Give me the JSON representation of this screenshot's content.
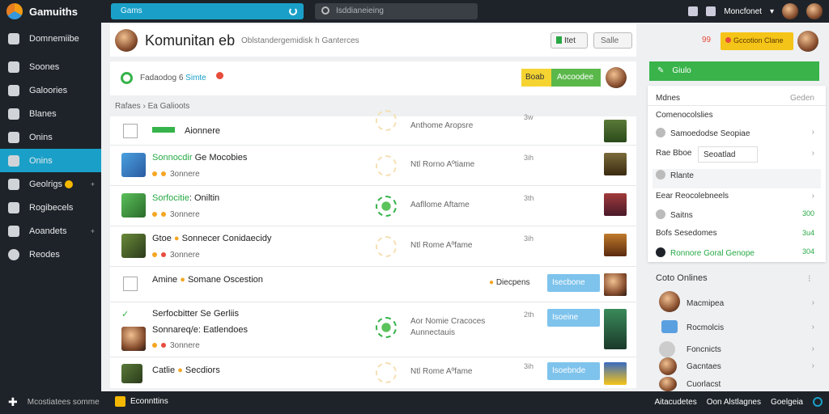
{
  "topbar": {
    "app_name": "Gamuiths",
    "tab_label": "Gams",
    "search_placeholder": "Isddianeieing",
    "user_name": "Moncfonet",
    "chevron": "▾"
  },
  "sidebar": {
    "items": [
      {
        "label": "Domnemiibe",
        "icon": "search-icon"
      },
      {
        "label": "Soones",
        "icon": "user-icon"
      },
      {
        "label": "Galoories",
        "icon": "people-icon"
      },
      {
        "label": "Blanes",
        "icon": "puzzle-icon"
      },
      {
        "label": "Onins",
        "icon": "monitor-icon"
      },
      {
        "label": "Onins",
        "icon": "list-icon",
        "active": true
      },
      {
        "label": "Geolrigs",
        "icon": "game-icon",
        "badge": true
      },
      {
        "label": "Rogibecels",
        "icon": "run-icon"
      },
      {
        "label": "Aoandets",
        "icon": "box-icon"
      },
      {
        "label": "Reodes",
        "icon": "info-icon"
      }
    ],
    "arrow": "+"
  },
  "header": {
    "title": "Komunitan eb",
    "subtitle": "Oblstandergemidisk h Ganterces",
    "btn_new": "Itet",
    "btn_sale": "Salle"
  },
  "status": {
    "text": "Fadaodog 6",
    "highlight": "Simte",
    "btn_yellow": "Boab",
    "btn_green": "Aocoodee"
  },
  "breadcrumb": "Rafaes  ›  Ea Galioots",
  "rows": [
    {
      "title": "Aionnere",
      "pill": true,
      "desc": "Anthome Aropsre",
      "num": "3w"
    },
    {
      "title": "Sonnocdir",
      "title2": " Ge Mocobies",
      "stars": "3onnere",
      "desc": "Ntl Rorno Aºtiame",
      "num": "3ih"
    },
    {
      "title": "Sorfocitie",
      "title2": ": Oniltin",
      "stars": "3onnere",
      "desc": "Aafllome Aftame",
      "num": "3th"
    },
    {
      "title": "Gtoe",
      "title2": " Sonnecer Conidaecidy",
      "stars": "3onnere",
      "desc": "Ntl Rome Aºfame",
      "num": "3ih"
    },
    {
      "title": "Amine",
      "title2": " Somane Oscestion",
      "right": "Diecpens",
      "blue": "Isecbone"
    },
    {
      "title": "Serfocbitter Se Gerliis",
      "title2": "Sonnareq/e: Eatlendoes",
      "stars": "3onnere",
      "desc": "Aor Nomie Cracoces",
      "desc2": "Aunnectauis",
      "num": "2th",
      "blue": "Isoeine"
    },
    {
      "title": "Catlie",
      "title2": " Secdiors",
      "desc": "Ntl Rome Aºfame",
      "num": "3ih",
      "blue": "Isoebnde"
    }
  ],
  "right": {
    "count": "99",
    "notif": "Gccotion Clane",
    "green_bar": "Giulo",
    "panel": {
      "header_left": "Mdnes",
      "header_right": "Geden",
      "section": "Comenocolslies",
      "items": [
        {
          "label": "Samoedodse Seopiae"
        },
        {
          "label": "Rae Bboe",
          "input": "Seoatlad"
        },
        {
          "label": "Rlante"
        },
        {
          "label": "Eear  Reocolebneels"
        },
        {
          "label": "Saitns",
          "val": "300"
        },
        {
          "label": "Bofs  Sesedomes",
          "val": "3u4"
        },
        {
          "label": "Ronnore Goral Genope",
          "val": "304"
        }
      ]
    },
    "online_title": "Coto Onlines",
    "online": [
      {
        "label": "Macmipea"
      },
      {
        "label": "Rocmolcis"
      },
      {
        "label": "Foncnicts"
      },
      {
        "label": "Gacntaes"
      },
      {
        "label": "Cuorlacst"
      }
    ]
  },
  "bottom": {
    "left": "Mcostiatees somme",
    "mid": "Econnttins",
    "r1": "Aitacudetes",
    "r2": "Oon Alstlagnes",
    "r3": "Goelgeia"
  }
}
